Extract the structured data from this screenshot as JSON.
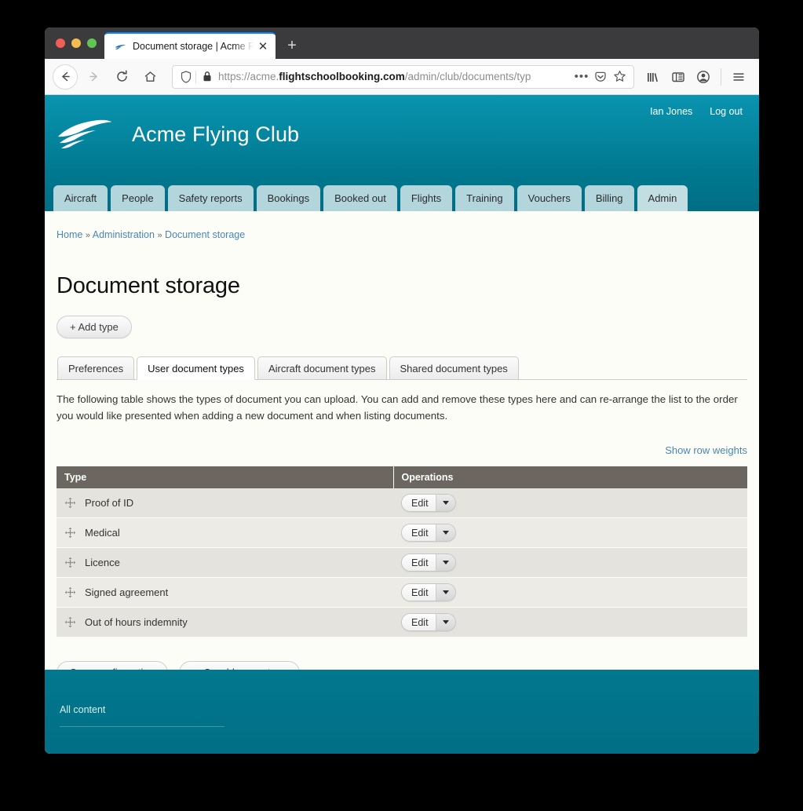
{
  "browser": {
    "tab": {
      "title": "Document storage | Acme Flying Club",
      "favicon_name": "acme-wings-favicon",
      "close_label": "✕"
    },
    "new_tab_label": "+",
    "nav": {
      "back_label": "←",
      "forward_label": "→",
      "reload_label": "⟳",
      "home_label": "⌂"
    },
    "url": {
      "scheme": "https://",
      "host_plain": "acme.",
      "host_bold": "flightschoolbooking.com",
      "path": "/admin/club/documents/typ",
      "full": "https://acme.flightschoolbooking.com/admin/club/documents/typ",
      "shield_icon": "tracking-protection-shield-icon",
      "lock_icon": "padlock-icon",
      "page_actions_label": "•••",
      "pocket_icon": "pocket-icon",
      "bookmark_icon": "star-icon"
    },
    "toolbar": {
      "library_icon": "library-icon",
      "sidebar_icon": "sidebar-icon",
      "account_icon": "account-icon",
      "menu_icon": "hamburger-menu-icon"
    }
  },
  "site": {
    "brand_name": "Acme Flying Club",
    "logo_name": "acme-wings-logo",
    "header_links": [
      {
        "label": "Ian Jones",
        "name": "user-account-link"
      },
      {
        "label": "Log out",
        "name": "logout-link"
      }
    ],
    "nav_tabs": [
      {
        "label": "Aircraft",
        "active": false
      },
      {
        "label": "People",
        "active": false
      },
      {
        "label": "Safety reports",
        "active": false
      },
      {
        "label": "Bookings",
        "active": false
      },
      {
        "label": "Booked out",
        "active": false
      },
      {
        "label": "Flights",
        "active": false
      },
      {
        "label": "Training",
        "active": false
      },
      {
        "label": "Vouchers",
        "active": false
      },
      {
        "label": "Billing",
        "active": false
      },
      {
        "label": "Admin",
        "active": true
      }
    ],
    "footer": {
      "link_label": "All content"
    }
  },
  "main": {
    "breadcrumb": [
      {
        "label": "Home"
      },
      {
        "label": "Administration"
      },
      {
        "label": "Document storage"
      }
    ],
    "breadcrumb_separator": "»",
    "page_title": "Document storage",
    "add_type_button": "+ Add type",
    "sub_tabs": [
      {
        "label": "Preferences",
        "active": false
      },
      {
        "label": "User document types",
        "active": true
      },
      {
        "label": "Aircraft document types",
        "active": false
      },
      {
        "label": "Shared document types",
        "active": false
      }
    ],
    "description": "The following table shows the types of document you can upload. You can add and remove these types here and can re-arrange the list to the order you would like presented when adding a new document and when listing documents.",
    "show_row_weights_label": "Show row weights",
    "table": {
      "columns": [
        "Type",
        "Operations"
      ],
      "rows": [
        {
          "type": "Proof of ID",
          "operation": "Edit",
          "drag_icon": "drag-handle-icon"
        },
        {
          "type": "Medical",
          "operation": "Edit",
          "drag_icon": "drag-handle-icon"
        },
        {
          "type": "Licence",
          "operation": "Edit",
          "drag_icon": "drag-handle-icon"
        },
        {
          "type": "Signed agreement",
          "operation": "Edit",
          "drag_icon": "drag-handle-icon"
        },
        {
          "type": "Out of hours indemnity",
          "operation": "Edit",
          "drag_icon": "drag-handle-icon"
        }
      ]
    },
    "save_button": "Save configuration",
    "add_new_type_button": "... Or add a new type"
  },
  "colors": {
    "brand_teal": "#00788f",
    "brand_teal_light": "#0a94b0",
    "nav_tab": "#b3d6dc",
    "nav_tab_active": "#c3dee3",
    "link_blue": "#4a86b6",
    "table_header": "#6b6760",
    "row_odd": "#e4e3de",
    "row_even": "#ecebe6",
    "page_bg": "#fdfdf8"
  }
}
